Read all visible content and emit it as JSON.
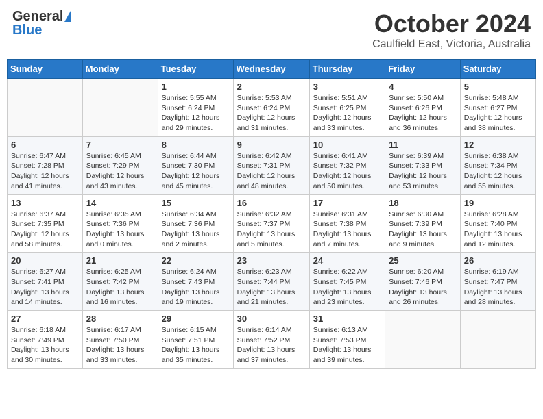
{
  "header": {
    "logo_general": "General",
    "logo_blue": "Blue",
    "month": "October 2024",
    "location": "Caulfield East, Victoria, Australia"
  },
  "days_of_week": [
    "Sunday",
    "Monday",
    "Tuesday",
    "Wednesday",
    "Thursday",
    "Friday",
    "Saturday"
  ],
  "weeks": [
    [
      {
        "day": "",
        "info": ""
      },
      {
        "day": "",
        "info": ""
      },
      {
        "day": "1",
        "info": "Sunrise: 5:55 AM\nSunset: 6:24 PM\nDaylight: 12 hours and 29 minutes."
      },
      {
        "day": "2",
        "info": "Sunrise: 5:53 AM\nSunset: 6:24 PM\nDaylight: 12 hours and 31 minutes."
      },
      {
        "day": "3",
        "info": "Sunrise: 5:51 AM\nSunset: 6:25 PM\nDaylight: 12 hours and 33 minutes."
      },
      {
        "day": "4",
        "info": "Sunrise: 5:50 AM\nSunset: 6:26 PM\nDaylight: 12 hours and 36 minutes."
      },
      {
        "day": "5",
        "info": "Sunrise: 5:48 AM\nSunset: 6:27 PM\nDaylight: 12 hours and 38 minutes."
      }
    ],
    [
      {
        "day": "6",
        "info": "Sunrise: 6:47 AM\nSunset: 7:28 PM\nDaylight: 12 hours and 41 minutes."
      },
      {
        "day": "7",
        "info": "Sunrise: 6:45 AM\nSunset: 7:29 PM\nDaylight: 12 hours and 43 minutes."
      },
      {
        "day": "8",
        "info": "Sunrise: 6:44 AM\nSunset: 7:30 PM\nDaylight: 12 hours and 45 minutes."
      },
      {
        "day": "9",
        "info": "Sunrise: 6:42 AM\nSunset: 7:31 PM\nDaylight: 12 hours and 48 minutes."
      },
      {
        "day": "10",
        "info": "Sunrise: 6:41 AM\nSunset: 7:32 PM\nDaylight: 12 hours and 50 minutes."
      },
      {
        "day": "11",
        "info": "Sunrise: 6:39 AM\nSunset: 7:33 PM\nDaylight: 12 hours and 53 minutes."
      },
      {
        "day": "12",
        "info": "Sunrise: 6:38 AM\nSunset: 7:34 PM\nDaylight: 12 hours and 55 minutes."
      }
    ],
    [
      {
        "day": "13",
        "info": "Sunrise: 6:37 AM\nSunset: 7:35 PM\nDaylight: 12 hours and 58 minutes."
      },
      {
        "day": "14",
        "info": "Sunrise: 6:35 AM\nSunset: 7:36 PM\nDaylight: 13 hours and 0 minutes."
      },
      {
        "day": "15",
        "info": "Sunrise: 6:34 AM\nSunset: 7:36 PM\nDaylight: 13 hours and 2 minutes."
      },
      {
        "day": "16",
        "info": "Sunrise: 6:32 AM\nSunset: 7:37 PM\nDaylight: 13 hours and 5 minutes."
      },
      {
        "day": "17",
        "info": "Sunrise: 6:31 AM\nSunset: 7:38 PM\nDaylight: 13 hours and 7 minutes."
      },
      {
        "day": "18",
        "info": "Sunrise: 6:30 AM\nSunset: 7:39 PM\nDaylight: 13 hours and 9 minutes."
      },
      {
        "day": "19",
        "info": "Sunrise: 6:28 AM\nSunset: 7:40 PM\nDaylight: 13 hours and 12 minutes."
      }
    ],
    [
      {
        "day": "20",
        "info": "Sunrise: 6:27 AM\nSunset: 7:41 PM\nDaylight: 13 hours and 14 minutes."
      },
      {
        "day": "21",
        "info": "Sunrise: 6:25 AM\nSunset: 7:42 PM\nDaylight: 13 hours and 16 minutes."
      },
      {
        "day": "22",
        "info": "Sunrise: 6:24 AM\nSunset: 7:43 PM\nDaylight: 13 hours and 19 minutes."
      },
      {
        "day": "23",
        "info": "Sunrise: 6:23 AM\nSunset: 7:44 PM\nDaylight: 13 hours and 21 minutes."
      },
      {
        "day": "24",
        "info": "Sunrise: 6:22 AM\nSunset: 7:45 PM\nDaylight: 13 hours and 23 minutes."
      },
      {
        "day": "25",
        "info": "Sunrise: 6:20 AM\nSunset: 7:46 PM\nDaylight: 13 hours and 26 minutes."
      },
      {
        "day": "26",
        "info": "Sunrise: 6:19 AM\nSunset: 7:47 PM\nDaylight: 13 hours and 28 minutes."
      }
    ],
    [
      {
        "day": "27",
        "info": "Sunrise: 6:18 AM\nSunset: 7:49 PM\nDaylight: 13 hours and 30 minutes."
      },
      {
        "day": "28",
        "info": "Sunrise: 6:17 AM\nSunset: 7:50 PM\nDaylight: 13 hours and 33 minutes."
      },
      {
        "day": "29",
        "info": "Sunrise: 6:15 AM\nSunset: 7:51 PM\nDaylight: 13 hours and 35 minutes."
      },
      {
        "day": "30",
        "info": "Sunrise: 6:14 AM\nSunset: 7:52 PM\nDaylight: 13 hours and 37 minutes."
      },
      {
        "day": "31",
        "info": "Sunrise: 6:13 AM\nSunset: 7:53 PM\nDaylight: 13 hours and 39 minutes."
      },
      {
        "day": "",
        "info": ""
      },
      {
        "day": "",
        "info": ""
      }
    ]
  ]
}
